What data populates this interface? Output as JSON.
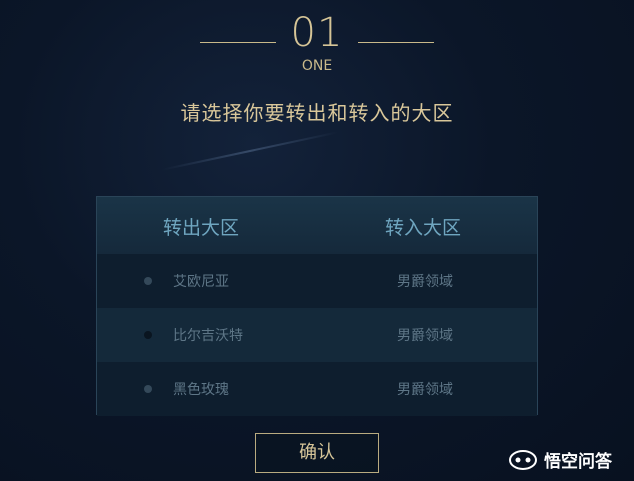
{
  "step": {
    "number": "01",
    "label": "ONE"
  },
  "instruction": "请选择你要转出和转入的大区",
  "table": {
    "headers": {
      "out": "转出大区",
      "in": "转入大区"
    },
    "rows": [
      {
        "out": "艾欧尼亚",
        "in": "男爵领域"
      },
      {
        "out": "比尔吉沃特",
        "in": "男爵领域"
      },
      {
        "out": "黑色玫瑰",
        "in": "男爵领域"
      }
    ]
  },
  "confirm_label": "确认",
  "watermark": {
    "text": "悟空问答"
  },
  "colors": {
    "gold": "#d6c597",
    "header_blue": "#6fa6c0",
    "background": "#0b1628"
  }
}
